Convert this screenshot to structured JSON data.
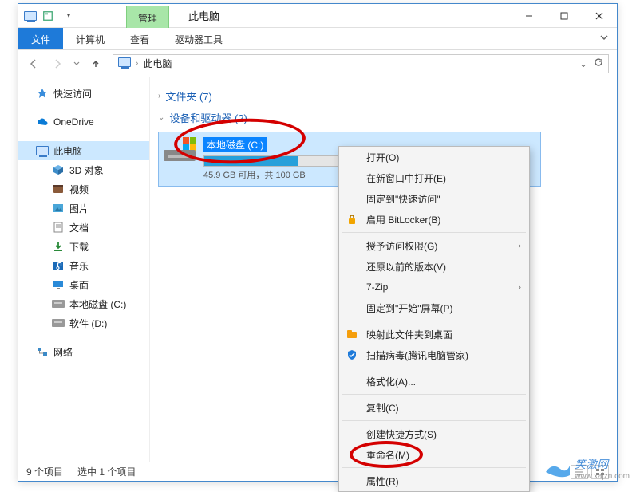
{
  "titlebar": {
    "context_tab": "管理",
    "title": "此电脑"
  },
  "menubar": {
    "file": "文件",
    "tabs": [
      "计算机",
      "查看"
    ],
    "context_tab": "驱动器工具"
  },
  "address": {
    "location": "此电脑"
  },
  "sidebar": {
    "quick_access": "快速访问",
    "onedrive": "OneDrive",
    "this_pc": "此电脑",
    "children": [
      "3D 对象",
      "视频",
      "图片",
      "文档",
      "下载",
      "音乐",
      "桌面",
      "本地磁盘 (C:)",
      "软件 (D:)"
    ],
    "network": "网络"
  },
  "content": {
    "group_folders": "文件夹 (7)",
    "group_drives": "设备和驱动器 (2)",
    "drive": {
      "name": "本地磁盘 (C:)",
      "subtext": "45.9 GB 可用，共 100 GB",
      "fill_percent": 54
    }
  },
  "context_menu": {
    "items": [
      {
        "label": "打开(O)",
        "sep_after": false
      },
      {
        "label": "在新窗口中打开(E)",
        "sep_after": false
      },
      {
        "label": "固定到\"快速访问\"",
        "sep_after": false
      },
      {
        "label": "启用 BitLocker(B)",
        "icon": "bitlocker",
        "sep_after": true
      },
      {
        "label": "授予访问权限(G)",
        "arrow": true,
        "sep_after": false
      },
      {
        "label": "还原以前的版本(V)",
        "sep_after": false
      },
      {
        "label": "7-Zip",
        "arrow": true,
        "sep_after": false
      },
      {
        "label": "固定到\"开始\"屏幕(P)",
        "sep_after": true
      },
      {
        "label": "映射此文件夹到桌面",
        "icon": "map-folder",
        "sep_after": false
      },
      {
        "label": "扫描病毒(腾讯电脑管家)",
        "icon": "shield",
        "sep_after": true
      },
      {
        "label": "格式化(A)...",
        "sep_after": true
      },
      {
        "label": "复制(C)",
        "sep_after": true
      },
      {
        "label": "创建快捷方式(S)",
        "sep_after": false
      },
      {
        "label": "重命名(M)",
        "sep_after": true
      },
      {
        "label": "属性(R)",
        "sep_after": false
      }
    ]
  },
  "statusbar": {
    "count": "9 个项目",
    "selection": "选中 1 个项目"
  },
  "watermark": {
    "main": "笑激网",
    "sub": "www.xajzn.com"
  }
}
